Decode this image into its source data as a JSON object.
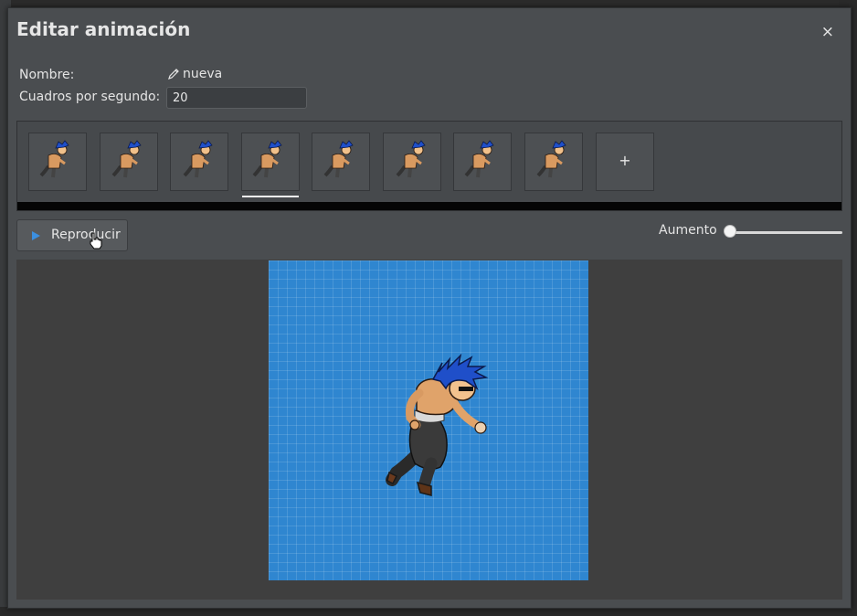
{
  "dialog": {
    "title": "Editar animación",
    "close_label": "×",
    "name_label": "Nombre:",
    "name_value": "nueva",
    "fps_label": "Cuadros por segundo:",
    "fps_value": "20"
  },
  "frames": {
    "count": 8,
    "selected_index": 3,
    "add_label": "+"
  },
  "controls": {
    "play_label": "Reproducir",
    "zoom_label": "Aumento",
    "zoom_level": 0
  },
  "colors": {
    "canvas_bg": "#2f86d0",
    "dialog_bg": "#4a4d50",
    "play_icon": "#3b8fe0"
  },
  "icons": {
    "name_edit": "pencil-icon",
    "play": "play-icon",
    "close": "close-icon",
    "cursor": "hand-cursor-icon"
  }
}
